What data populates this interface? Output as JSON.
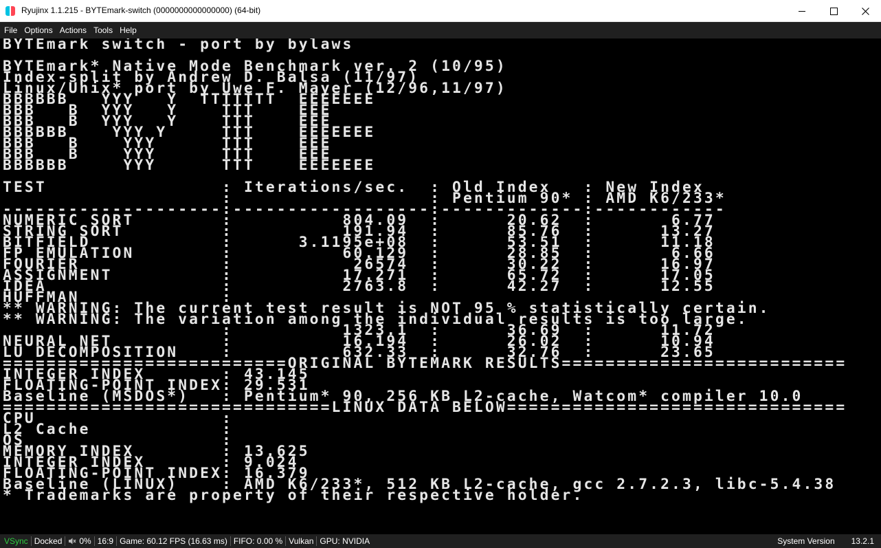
{
  "window": {
    "title": "Ryujinx 1.1.215 - BYTEmark-switch (0000000000000000) (64-bit)"
  },
  "menu": [
    "File",
    "Options",
    "Actions",
    "Tools",
    "Help"
  ],
  "terminal": {
    "lines": [
      "BYTEmark switch - port by bylaws",
      "",
      "BYTEmark* Native Mode Benchmark ver. 2 (10/95)",
      "Index-split by Andrew D. Balsa (11/97)",
      "Linux/Unix* port by Uwe F. Mayer (12/96,11/97)",
      "BBBBBB   YYY   Y  TTTTTTT  EEEEEEE",
      "BBB   B  YYY   Y    TTT    EEE",
      "BBB   B  YYY   Y    TTT    EEE",
      "BBBBBB    YYY Y     TTT    EEEEEEE",
      "BBB   B    YYY      TTT    EEE",
      "BBB   B    YYY      TTT    EEE",
      "BBBBBB     YYY      TTT    EEEEEEE",
      "",
      "TEST                : Iterations/sec.  : Old Index   : New Index",
      "                    :                  : Pentium 90* : AMD K6/233*",
      "--------------------:------------------:-------------:------------",
      "NUMERIC SORT        :          804.09  :      20.62  :       6.77",
      "STRING SORT         :          191.94  :      85.76  :      13.27",
      "BITFIELD            :      3.1195e+08  :      53.51  :      11.18",
      "FP EMULATION        :          60.129  :      28.85  :       6.66",
      "FOURIER             :           26574  :      30.22  :      16.97",
      "ASSIGNMENT          :          17.271  :      65.72  :      17.05",
      "IDEA                :          2763.8  :      42.27  :      12.55",
      "HUFFMAN             :",
      "** WARNING: The current test result is NOT 95 % statistically certain.",
      "** WARNING: The variation among the individual results is too large.",
      "                    :          1323.1  :      36.69  :      11.72",
      "NEURAL NET          :          16.194  :      26.02  :      10.94",
      "LU DECOMPOSITION    :          632.33  :      32.76  :      23.65",
      "==========================ORIGINAL BYTEMARK RESULTS==========================",
      "INTEGER INDEX       : 43.145",
      "FLOATING-POINT INDEX: 29.531",
      "Baseline (MSDOS*)   : Pentium* 90, 256 KB L2-cache, Watcom* compiler 10.0",
      "==============================LINUX DATA BELOW===============================",
      "CPU                 :",
      "L2 Cache            :",
      "OS                  :",
      "MEMORY INDEX        : 13.625",
      "INTEGER INDEX       : 9.024",
      "FLOATING-POINT INDEX: 16.379",
      "Baseline (LINUX)    : AMD K6/233*, 512 KB L2-cache, gcc 2.7.2.3, libc-5.4.38",
      "* Trademarks are property of their respective holder."
    ]
  },
  "status": {
    "vsync": "VSync",
    "docked": "Docked",
    "volume": "0%",
    "aspect": "16:9",
    "fps": "Game: 60.12 FPS (16.63 ms)",
    "fifo": "FIFO: 0.00 %",
    "backend": "Vulkan",
    "gpu": "GPU: NVIDIA",
    "system_version_label": "System Version",
    "system_version": "13.2.1"
  },
  "colors": {
    "vsync": "#2ecc40",
    "menubar": "#202020",
    "terminal_text": "#e6e6e6"
  }
}
